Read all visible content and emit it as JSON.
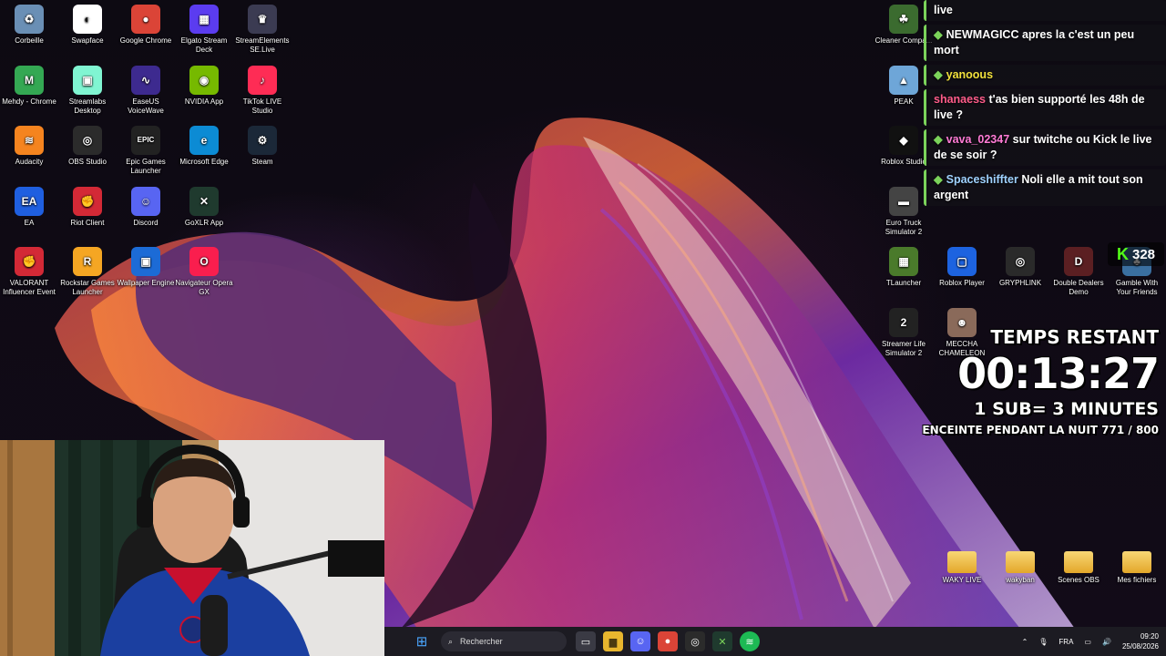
{
  "desktop_left": [
    {
      "label": "Corbeille",
      "icon": "recycle-bin-icon",
      "color": "#6a8fb5",
      "glyph": "♻"
    },
    {
      "label": "Swapface",
      "icon": "mask-icon",
      "color": "#ffffff",
      "glyph": "◐"
    },
    {
      "label": "Google Chrome",
      "icon": "chrome-icon",
      "color": "#db4437",
      "glyph": "●"
    },
    {
      "label": "Elgato Stream Deck",
      "icon": "stream-deck-icon",
      "color": "#5b3cf0",
      "glyph": "▦"
    },
    {
      "label": "StreamElements SE.Live",
      "icon": "streamelements-icon",
      "color": "#3b3b52",
      "glyph": "♛"
    },
    {
      "label": "Mehdy - Chrome",
      "icon": "chrome-profile-icon",
      "color": "#34a853",
      "glyph": "M"
    },
    {
      "label": "Streamlabs Desktop",
      "icon": "streamlabs-icon",
      "color": "#80f5d2",
      "glyph": "▣"
    },
    {
      "label": "EaseUS VoiceWave",
      "icon": "voicewave-icon",
      "color": "#3d2a8f",
      "glyph": "∿"
    },
    {
      "label": "NVIDIA App",
      "icon": "nvidia-icon",
      "color": "#76b900",
      "glyph": "◉"
    },
    {
      "label": "TikTok LIVE Studio",
      "icon": "tiktok-icon",
      "color": "#fe2c55",
      "glyph": "♪"
    },
    {
      "label": "Audacity",
      "icon": "audacity-icon",
      "color": "#f5841f",
      "glyph": "≋"
    },
    {
      "label": "OBS Studio",
      "icon": "obs-icon",
      "color": "#2b2b2b",
      "glyph": "◎"
    },
    {
      "label": "Epic Games Launcher",
      "icon": "epic-games-icon",
      "color": "#222222",
      "glyph": "EPIC"
    },
    {
      "label": "Microsoft Edge",
      "icon": "edge-icon",
      "color": "#0c8bd4",
      "glyph": "e"
    },
    {
      "label": "Steam",
      "icon": "steam-icon",
      "color": "#1b2838",
      "glyph": "⚙"
    },
    {
      "label": "EA",
      "icon": "ea-icon",
      "color": "#1f5fe0",
      "glyph": "EA"
    },
    {
      "label": "Riot Client",
      "icon": "riot-icon",
      "color": "#d32936",
      "glyph": "✊"
    },
    {
      "label": "Discord",
      "icon": "discord-icon",
      "color": "#5865f2",
      "glyph": "☺"
    },
    {
      "label": "GoXLR App",
      "icon": "goxlr-icon",
      "color": "#1f3a2e",
      "glyph": "✕"
    },
    {
      "label": "",
      "icon": "",
      "color": "",
      "glyph": ""
    },
    {
      "label": "VALORANT Influencer Event",
      "icon": "riot-icon",
      "color": "#d32936",
      "glyph": "✊"
    },
    {
      "label": "Rockstar Games Launcher",
      "icon": "rockstar-icon",
      "color": "#f5a623",
      "glyph": "R"
    },
    {
      "label": "Wallpaper Engine",
      "icon": "wallpaper-engine-icon",
      "color": "#1c6bd6",
      "glyph": "▣"
    },
    {
      "label": "Navigateur Opera GX",
      "icon": "opera-gx-icon",
      "color": "#fa1e4e",
      "glyph": "O"
    }
  ],
  "desktop_right": [
    {
      "label": "Cleaner Compa...",
      "icon": "cleaner-icon",
      "color": "#3b6b2f",
      "glyph": "☘"
    },
    {
      "label": "PEAK",
      "icon": "peak-icon",
      "color": "#6ea6d8",
      "glyph": "▲"
    },
    {
      "label": "Roblox Studio",
      "icon": "roblox-studio-icon",
      "color": "#111111",
      "glyph": "◆"
    },
    {
      "label": "Euro Truck Simulator 2",
      "icon": "truck-icon",
      "color": "#444444",
      "glyph": "▬"
    },
    {
      "label": "TLauncher",
      "icon": "minecraft-icon",
      "color": "#4a7a2b",
      "glyph": "▦"
    },
    {
      "label": "Roblox Player",
      "icon": "roblox-icon",
      "color": "#1d63e0",
      "glyph": "▢"
    },
    {
      "label": "GRYPHLINK",
      "icon": "gryphlink-icon",
      "color": "#2a2a2a",
      "glyph": "◎"
    },
    {
      "label": "Double Dealers Demo",
      "icon": "double-dealers-icon",
      "color": "#5b1f22",
      "glyph": "D"
    },
    {
      "label": "Gamble With Your Friends",
      "icon": "gamble-icon",
      "color": "#3a6fa0",
      "glyph": "♣"
    },
    {
      "label": "Streamer Life Simulator 2",
      "icon": "streamer-life-icon",
      "color": "#222222",
      "glyph": "2"
    },
    {
      "label": "MECCHA CHAMELEON",
      "icon": "chameleon-icon",
      "color": "#8a6a5a",
      "glyph": "☻"
    }
  ],
  "chat": [
    {
      "user": "",
      "text": "live",
      "user_color": "#ffffff"
    },
    {
      "user": "NEWMAGICC",
      "text": "apres la c'est un peu mort",
      "user_color": "#ffffff"
    },
    {
      "user": "yanoous",
      "text": "",
      "user_color": "#f1e03c"
    },
    {
      "user": "shanaess",
      "text": "t'as bien supporté les 48h de live ?",
      "user_color": "#ff5c8a"
    },
    {
      "user": "vava_02347",
      "text": "sur twitche ou Kick le live de se soir ?",
      "user_color": "#ff7bd5"
    },
    {
      "user": "Spaceshiffter",
      "text": "Noli elle a mit tout son argent",
      "user_color": "#9fd2ff"
    }
  ],
  "kick": {
    "label": "K",
    "count": "328"
  },
  "timer": {
    "title": "TEMPS RESTANT",
    "time": "00:13:27",
    "rate": "1 SUB= 3 MINUTES",
    "goal": "ENCEINTE PENDANT LA NUIT 771 / 800"
  },
  "folders": [
    {
      "label": "WAKY LIVE"
    },
    {
      "label": "wakyban"
    },
    {
      "label": "Scenes OBS"
    },
    {
      "label": "Mes fichiers"
    }
  ],
  "taskbar": {
    "search_placeholder": "Rechercher",
    "lang": "FRA",
    "time": "09:20",
    "date": "25/08/2026"
  }
}
